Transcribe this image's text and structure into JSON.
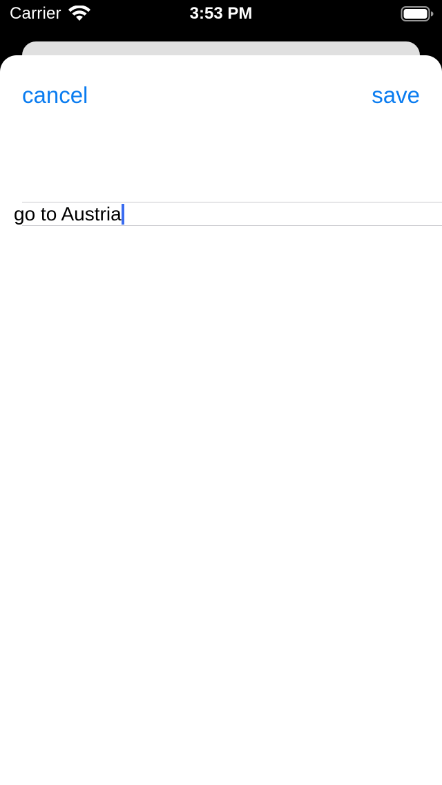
{
  "status_bar": {
    "carrier": "Carrier",
    "time": "3:53 PM",
    "wifi_icon": "wifi-icon",
    "battery_icon": "battery-icon"
  },
  "sheet": {
    "cancel_label": "cancel",
    "save_label": "save",
    "text_field_value": "go to Austria"
  },
  "colors": {
    "accent": "#0a7cf0",
    "cursor": "#3a6cf0",
    "separator": "#c8c8cc",
    "status_bar_bg": "#000000",
    "back_card": "#e0e0e0"
  }
}
